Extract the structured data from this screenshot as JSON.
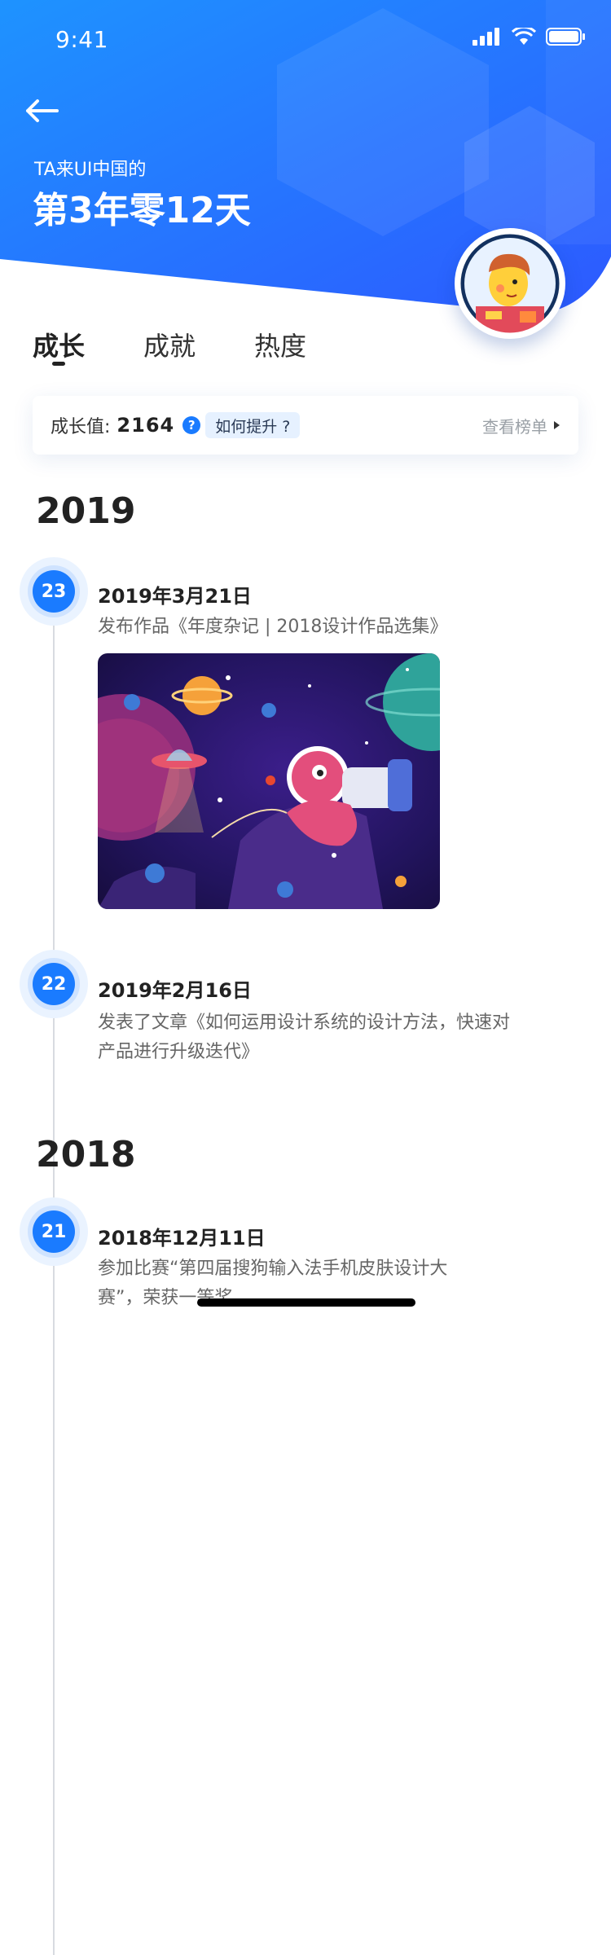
{
  "status_bar": {
    "time": "9:41"
  },
  "header": {
    "caption": "TA来UI中国的",
    "duration": "第3年零12天"
  },
  "tabs": [
    {
      "label": "成长",
      "active": true
    },
    {
      "label": "成就",
      "active": false
    },
    {
      "label": "热度",
      "active": false
    }
  ],
  "growth": {
    "label": "成长值:",
    "value": "2164",
    "help_label": "?",
    "how_label": "如何提升 ?",
    "rank_label": "查看榜单"
  },
  "timeline": [
    {
      "year": "2019",
      "events": [
        {
          "day": "23",
          "date": "2019年3月21日",
          "desc": "发布作品《年度杂记 | 2018设计作品选集》"
        },
        {
          "day": "22",
          "date": "2019年2月16日",
          "desc": "发表了文章《如何运用设计系统的设计方法，快速对产品进行升级迭代》"
        }
      ]
    },
    {
      "year": "2018",
      "events": [
        {
          "day": "21",
          "date": "2018年12月11日",
          "desc": "参加比赛“第四届搜狗输入法手机皮肤设计大赛”，荣获一等奖"
        }
      ]
    }
  ],
  "colors": {
    "brand_blue": "#1a7bff",
    "header_gradient_start": "#1a8cff",
    "header_gradient_end": "#2f5cff"
  },
  "icons": {
    "back": "arrow-left-icon",
    "help": "question-circle-icon",
    "rank": "caret-right-icon"
  }
}
